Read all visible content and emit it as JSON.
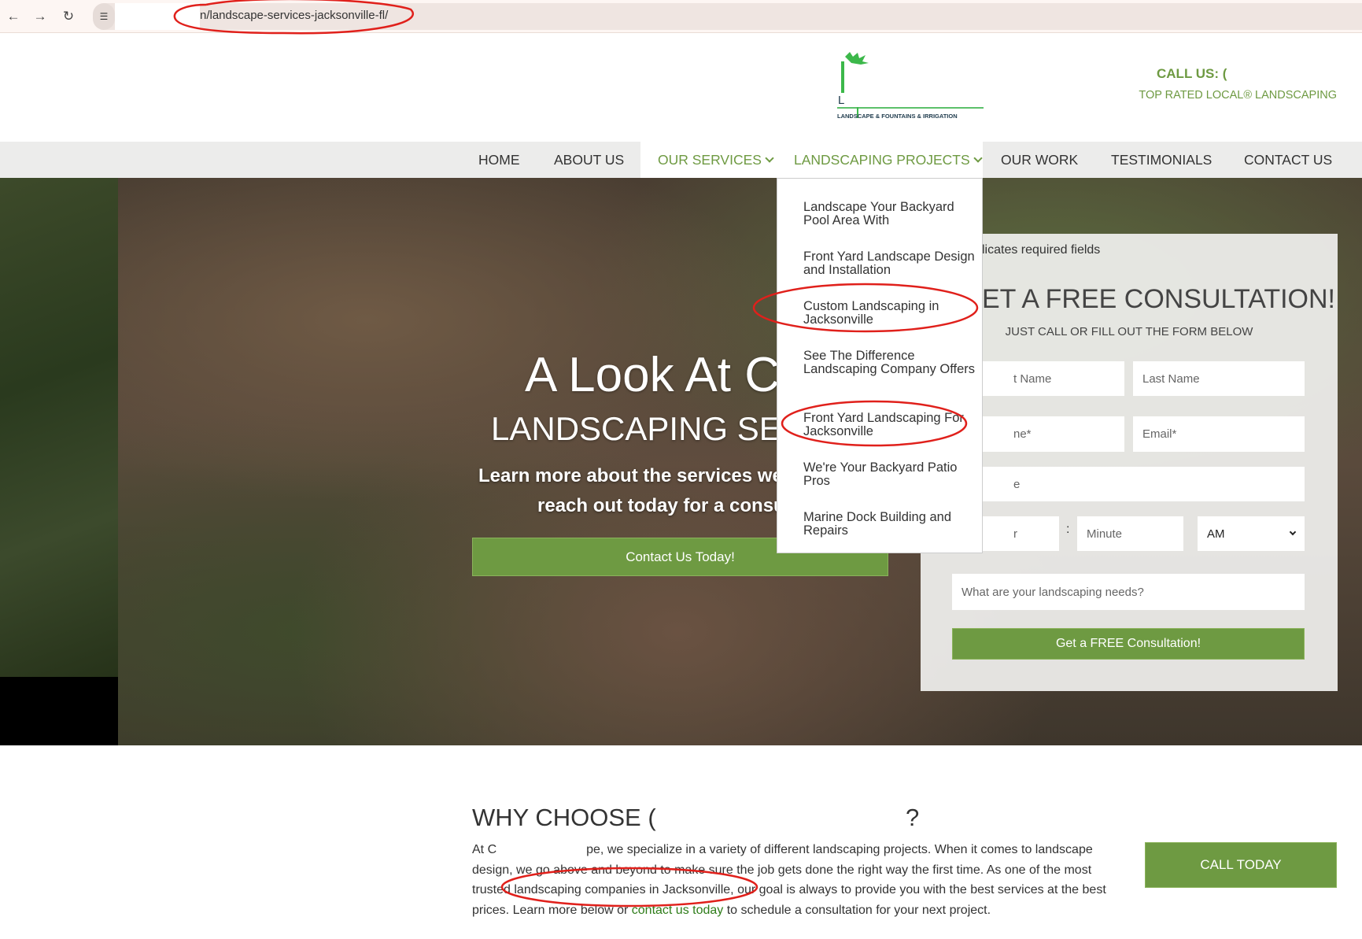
{
  "browser": {
    "url": "n/landscape-services-jacksonville-fl/",
    "back_icon": "arrow-left-icon",
    "forward_icon": "arrow-right-icon",
    "reload_icon": "reload-icon",
    "site_info_icon": "tune-icon"
  },
  "header": {
    "logo_letter": "L",
    "logo_tagline": "LANDSCAPE & FOUNTAINS & IRRIGATION",
    "call_us": "CALL US: (",
    "tagline": "TOP RATED LOCAL® LANDSCAPING"
  },
  "nav": {
    "items": [
      {
        "label": "HOME"
      },
      {
        "label": "ABOUT US"
      },
      {
        "label": "OUR SERVICES"
      },
      {
        "label": "LANDSCAPING PROJECTS"
      },
      {
        "label": "OUR WORK"
      },
      {
        "label": "TESTIMONIALS"
      },
      {
        "label": "CONTACT US"
      }
    ]
  },
  "dropdown": {
    "items": [
      {
        "label": "Landscape Your Backyard Pool Area With"
      },
      {
        "label": "Front Yard Landscape Design and Installation"
      },
      {
        "label": "Custom Landscaping in Jacksonville"
      },
      {
        "label": "See The Difference Landscaping Company Offers"
      },
      {
        "label": "Front Yard Landscaping For Jacksonville"
      },
      {
        "label": "We're Your Backyard Patio Pros"
      },
      {
        "label": "Marine Dock Building and Repairs"
      }
    ]
  },
  "hero": {
    "title": "A Look At C",
    "subtitle": "LANDSCAPING SER",
    "line1": "Learn more about the services we o",
    "line2": "reach out today for a consult",
    "button": "Contact Us Today!"
  },
  "form": {
    "required_note": "licates required fields",
    "heading": "ET A FREE CONSULTATION!",
    "subheading": "JUST CALL OR FILL OUT THE FORM BELOW",
    "first_name": "t Name",
    "last_name": "Last Name",
    "phone": "ne*",
    "email": "Email*",
    "field3": "e",
    "hour": "r",
    "colon": ":",
    "minute": "Minute",
    "ampm": "AM",
    "needs": "What are your landscaping needs?",
    "submit": "Get a FREE Consultation!"
  },
  "why": {
    "heading": "WHY CHOOSE (",
    "heading_end": "?",
    "lines": [
      "At C",
      "pe, we specialize in a variety of different landscaping projects. When it comes to landscape",
      "design, we go above and beyond to make sure the job gets done the right way the first time. As one of the most",
      "trusted landscaping companies in Jacksonville, our goal is always to provide you with the best services at the best",
      "prices. Learn more below or ",
      "contact us today",
      " to schedule a consultation for your next project."
    ],
    "call_button": "CALL TODAY"
  },
  "colors": {
    "brand_green": "#6e9a42",
    "link_green": "#2f7d1a",
    "annotation_red": "#e0201b"
  }
}
